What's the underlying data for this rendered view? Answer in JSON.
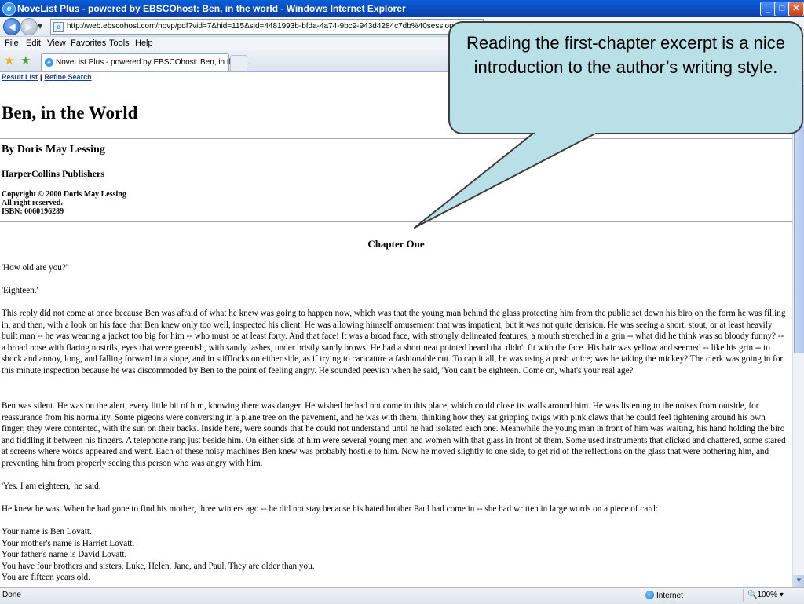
{
  "window": {
    "title": "NoveList Plus - powered by EBSCOhost: Ben, in the world - Windows Internet Explorer",
    "min_symbol": "_",
    "max_symbol": "□",
    "close_symbol": "✕"
  },
  "address": {
    "url": "http://web.ebscohost.com/novp/pdf?vid=7&hid=115&sid=4481993b-bfda-4a74-9bc9-943d4284c7db%40sessionmgr109"
  },
  "menu": {
    "items": [
      "File",
      "Edit",
      "View",
      "Favorites",
      "Tools",
      "Help"
    ]
  },
  "tab": {
    "label": "NoveList Plus - powered by EBSCOhost: Ben, in the w..."
  },
  "page": {
    "links": {
      "result_list": "Result List",
      "separator": "|",
      "refine_search": "Refine Search"
    },
    "title": "Ben, in the World",
    "author": "By Doris May Lessing",
    "publisher": "HarperCollins Publishers",
    "copyright_lines": [
      "Copyright © 2000 Doris May Lessing",
      "All right reserved.",
      "ISBN: 0060196289"
    ],
    "chapter_heading": "Chapter One",
    "paragraphs": [
      "'How old are you?'",
      "'Eighteen.'",
      "This reply did not come at once because Ben was afraid of what he knew was going to happen now, which was that the young man behind the glass protecting him from the public set down his biro on the form he was filling in, and then, with a look on his face that Ben knew only too well, inspected his client. He was allowing himself amusement that was impatient, but it was not quite derision. He was seeing a short, stout, or at least heavily built man -- he was wearing a jacket too big for him -- who must be at least forty. And that face! It was a broad face, with strongly delineated features, a mouth stretched in a grin -- what did he think was so bloody funny? -- a broad nose with flaring nostrils, eyes that were greenish, with sandy lashes, under bristly sandy brows. He had a short neat pointed beard that didn't fit with the face. His hair was yellow and seemed -- like his grin -- to shock and annoy, long, and falling forward in a slope, and in stifflocks on either side, as if trying to caricature a fashionable cut. To cap it all, he was using a posh voice; was he taking the mickey? The clerk was going in for this minute inspection because he was discommoded by Ben to the point of feeling angry. He sounded peevish when he said, 'You can't be eighteen. Come on, what's your real age?'",
      "Ben was silent. He was on the alert, every little bit of him, knowing there was danger. He wished he had not come to this place, which could close its walls around him. He was listening to the noises from outside, for reassurance from his normality. Some pigeons were conversing in a plane tree on the pavement, and he was with them, thinking how they sat gripping twigs with pink claws that he could feel tightening around his own finger; they were contented, with the sun on their backs. Inside here, were sounds that he could not understand until he had isolated each one. Meanwhile the young man in front of him was waiting, his hand holding the biro and fiddling it between his fingers. A telephone rang just beside him. On either side of him were several young men and women with that glass in front of them. Some used instruments that clicked and chattered, some stared at screens where words appeared and went. Each of these noisy machines Ben knew was probably hostile to him. Now he moved slightly to one side, to get rid of the reflections on the glass that were bothering him, and preventing him from properly seeing this person who was angry with him.",
      "'Yes. I am eighteen,' he said.",
      "He knew he was. When he had gone to find his mother, three winters ago -- he did not stay because his hated brother Paul had come in -- she had written in large words on a piece of card:"
    ],
    "card_lines": [
      "Your name is Ben Lovatt.",
      "Your mother's name is Harriet Lovatt.",
      "Your father's name is David Lovatt.",
      "You have four brothers and sisters, Luke, Helen, Jane, and Paul. They are older than you.",
      "You are fifteen years old."
    ]
  },
  "status": {
    "text": "Done",
    "zone": "Internet",
    "zoom": "100%"
  },
  "callout": {
    "text": "Reading the first-chapter excerpt is a nice introduction to the author’s writing style."
  }
}
